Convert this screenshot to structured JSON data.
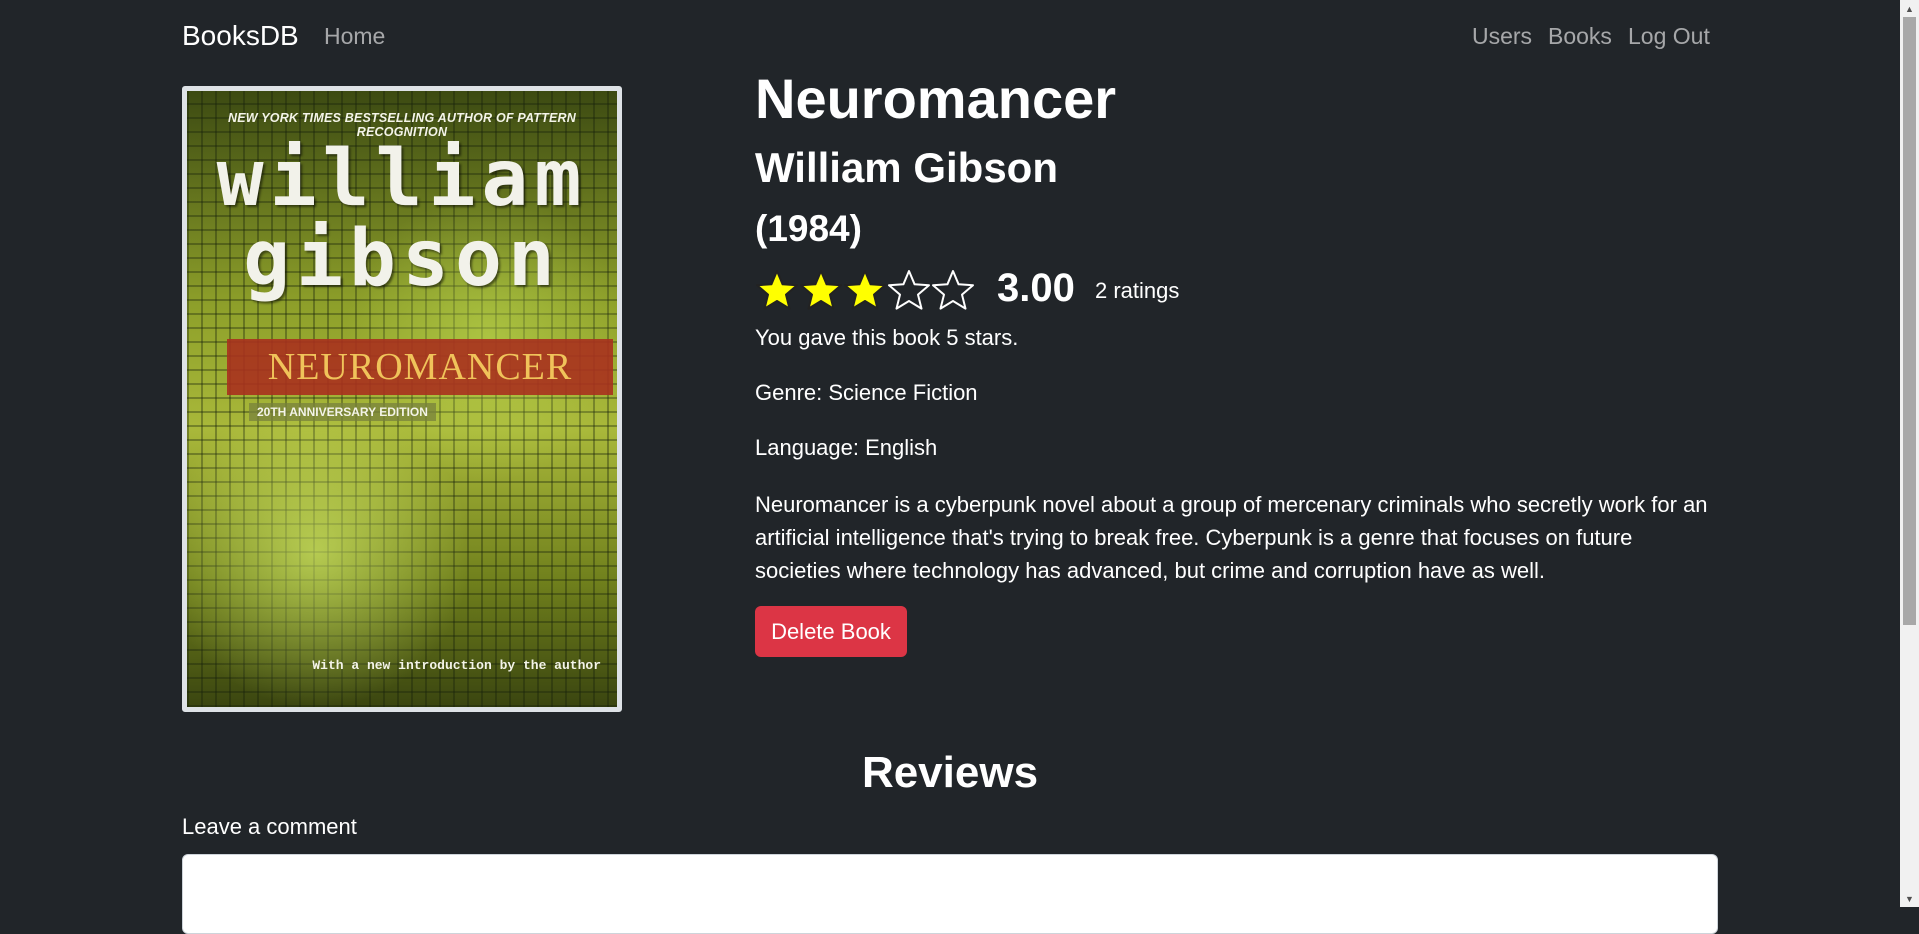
{
  "navbar": {
    "brand": "BooksDB",
    "home": "Home",
    "users": "Users",
    "books": "Books",
    "logout": "Log Out"
  },
  "cover": {
    "top_text": "NEW YORK TIMES BESTSELLING AUTHOR OF PATTERN RECOGNITION",
    "author_line1": "william",
    "author_line2": "gibson",
    "title": "NEUROMANCER",
    "edition": "20TH ANNIVERSARY EDITION",
    "footer": "With a new introduction by the author"
  },
  "book": {
    "title": "Neuromancer",
    "author": "William Gibson",
    "year": "(1984)",
    "rating_value": 3,
    "rating_max": 5,
    "average_rating": "3.00",
    "rating_count": "2 ratings",
    "user_rating_text": "You gave this book 5 stars.",
    "genre": "Genre: Science Fiction",
    "language": "Language: English",
    "description": "Neuromancer is a cyberpunk novel about a group of mercenary criminals who secretly work for an artificial intelligence that's trying to break free. Cyberpunk is a genre that focuses on future societies where technology has advanced, but crime and corruption have as well.",
    "delete_label": "Delete Book"
  },
  "reviews": {
    "heading": "Reviews",
    "comment_label": "Leave a comment",
    "comment_value": ""
  },
  "colors": {
    "background": "#212529",
    "star_fill": "#ffff00",
    "danger": "#dc3545"
  }
}
